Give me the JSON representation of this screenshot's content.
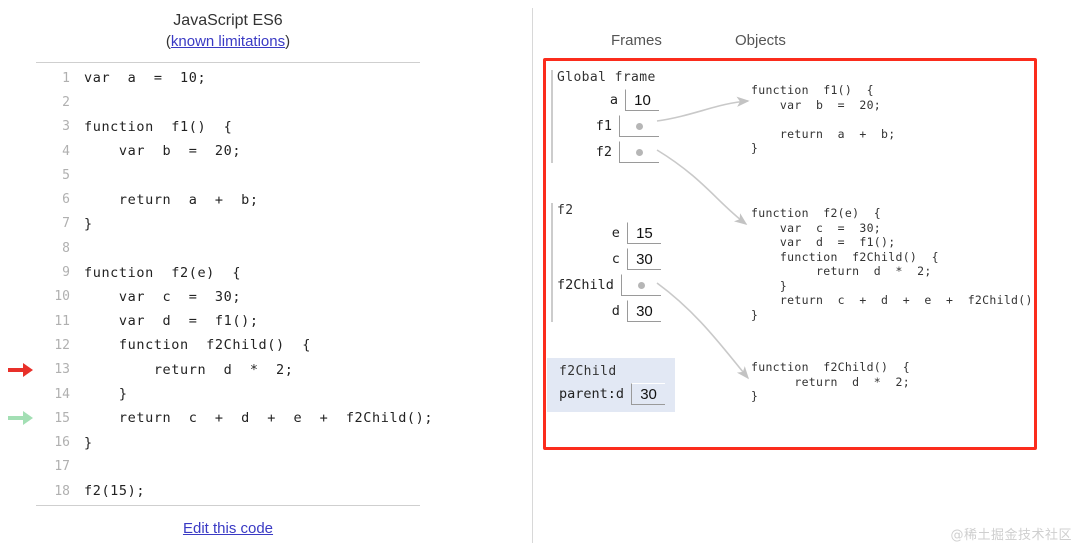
{
  "code_panel": {
    "title": "JavaScript ES6",
    "subtitle_open": "(",
    "subtitle_link": "known limitations",
    "subtitle_close": ")",
    "edit_link": "Edit this code",
    "lines": [
      {
        "n": "1",
        "text": "var  a  =  10;",
        "arrow": "none"
      },
      {
        "n": "2",
        "text": "",
        "arrow": "none"
      },
      {
        "n": "3",
        "text": "function  f1()  {",
        "arrow": "none"
      },
      {
        "n": "4",
        "text": "    var  b  =  20;",
        "arrow": "none"
      },
      {
        "n": "5",
        "text": "",
        "arrow": "none"
      },
      {
        "n": "6",
        "text": "    return  a  +  b;",
        "arrow": "none"
      },
      {
        "n": "7",
        "text": "}",
        "arrow": "none"
      },
      {
        "n": "8",
        "text": "",
        "arrow": "none"
      },
      {
        "n": "9",
        "text": "function  f2(e)  {",
        "arrow": "none"
      },
      {
        "n": "10",
        "text": "    var  c  =  30;",
        "arrow": "none"
      },
      {
        "n": "11",
        "text": "    var  d  =  f1();",
        "arrow": "none"
      },
      {
        "n": "12",
        "text": "    function  f2Child()  {",
        "arrow": "none"
      },
      {
        "n": "13",
        "text": "        return  d  *  2;",
        "arrow": "red"
      },
      {
        "n": "14",
        "text": "    }",
        "arrow": "none"
      },
      {
        "n": "15",
        "text": "    return  c  +  d  +  e  +  f2Child();",
        "arrow": "green"
      },
      {
        "n": "16",
        "text": "}",
        "arrow": "none"
      },
      {
        "n": "17",
        "text": "",
        "arrow": "none"
      },
      {
        "n": "18",
        "text": "f2(15);",
        "arrow": "none"
      }
    ],
    "arrow_colors": {
      "red": "#e8302a",
      "green": "#a3dfb4"
    }
  },
  "viz": {
    "frames_header": "Frames",
    "objects_header": "Objects",
    "highlight_color": "#e2e8f4",
    "border_color": "#fb2c1c",
    "frames": [
      {
        "title": "Global frame",
        "highlight": false,
        "vars": [
          {
            "name": "a",
            "value": "10",
            "pointer": false
          },
          {
            "name": "f1",
            "value": "",
            "pointer": true
          },
          {
            "name": "f2",
            "value": "",
            "pointer": true
          }
        ]
      },
      {
        "title": "f2",
        "highlight": false,
        "vars": [
          {
            "name": "e",
            "value": "15",
            "pointer": false
          },
          {
            "name": "c",
            "value": "30",
            "pointer": false
          },
          {
            "name": "f2Child",
            "value": "",
            "pointer": true
          },
          {
            "name": "d",
            "value": "30",
            "pointer": false
          }
        ]
      },
      {
        "title": "f2Child",
        "highlight": true,
        "vars": [
          {
            "name": "parent:d",
            "value": "30",
            "pointer": false
          }
        ]
      }
    ],
    "objects": [
      {
        "code": "function  f1()  {\n    var  b  =  20;\n\n    return  a  +  b;\n}"
      },
      {
        "code": "function  f2(e)  {\n    var  c  =  30;\n    var  d  =  f1();\n    function  f2Child()  {\n         return  d  *  2;\n    }\n    return  c  +  d  +  e  +  f2Child();\n}"
      },
      {
        "code": "function  f2Child()  {\n      return  d  *  2;\n}"
      }
    ]
  },
  "watermark": "@稀土掘金技术社区"
}
